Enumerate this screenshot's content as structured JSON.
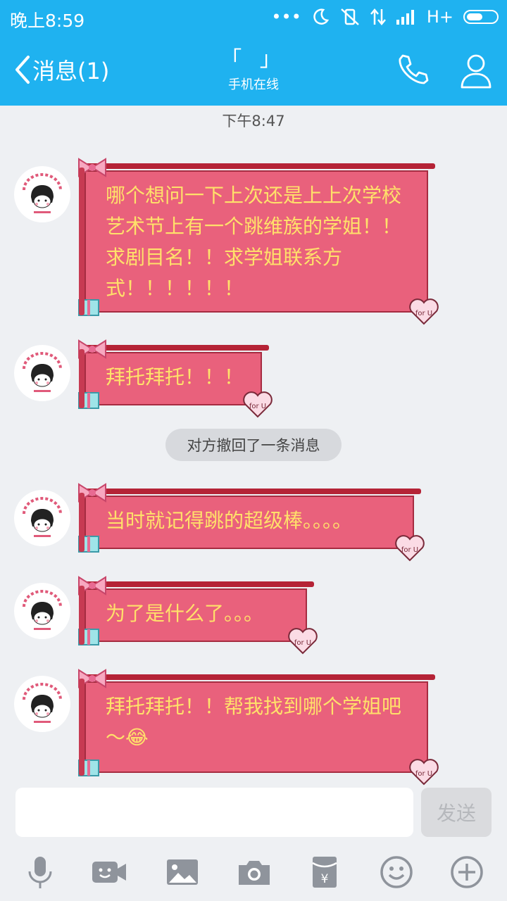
{
  "status": {
    "time": "晚上8:59",
    "network": "H+"
  },
  "nav": {
    "back_label": "消息(1)",
    "title": "「 」",
    "subtitle": "手机在线"
  },
  "chat": {
    "timestamp": "下午8:47",
    "messages": [
      {
        "text": "哪个想问一下上次还是上上次学校艺术节上有一个跳维族的学姐！！求剧目名！！求学姐联系方式！！！！！！"
      },
      {
        "text": "拜托拜托！！！"
      },
      {
        "text": "当时就记得跳的超级棒。。。。"
      },
      {
        "text": "为了是什么了。。。"
      },
      {
        "text": "拜托拜托！！帮我找到哪个学姐吧～😂"
      }
    ],
    "recall_notice": "对方撤回了一条消息"
  },
  "input": {
    "value": "",
    "send_label": "发送"
  },
  "colors": {
    "header": "#1fb2f0",
    "bubble": "#e9617c",
    "bubble_text": "#ffe16a"
  }
}
